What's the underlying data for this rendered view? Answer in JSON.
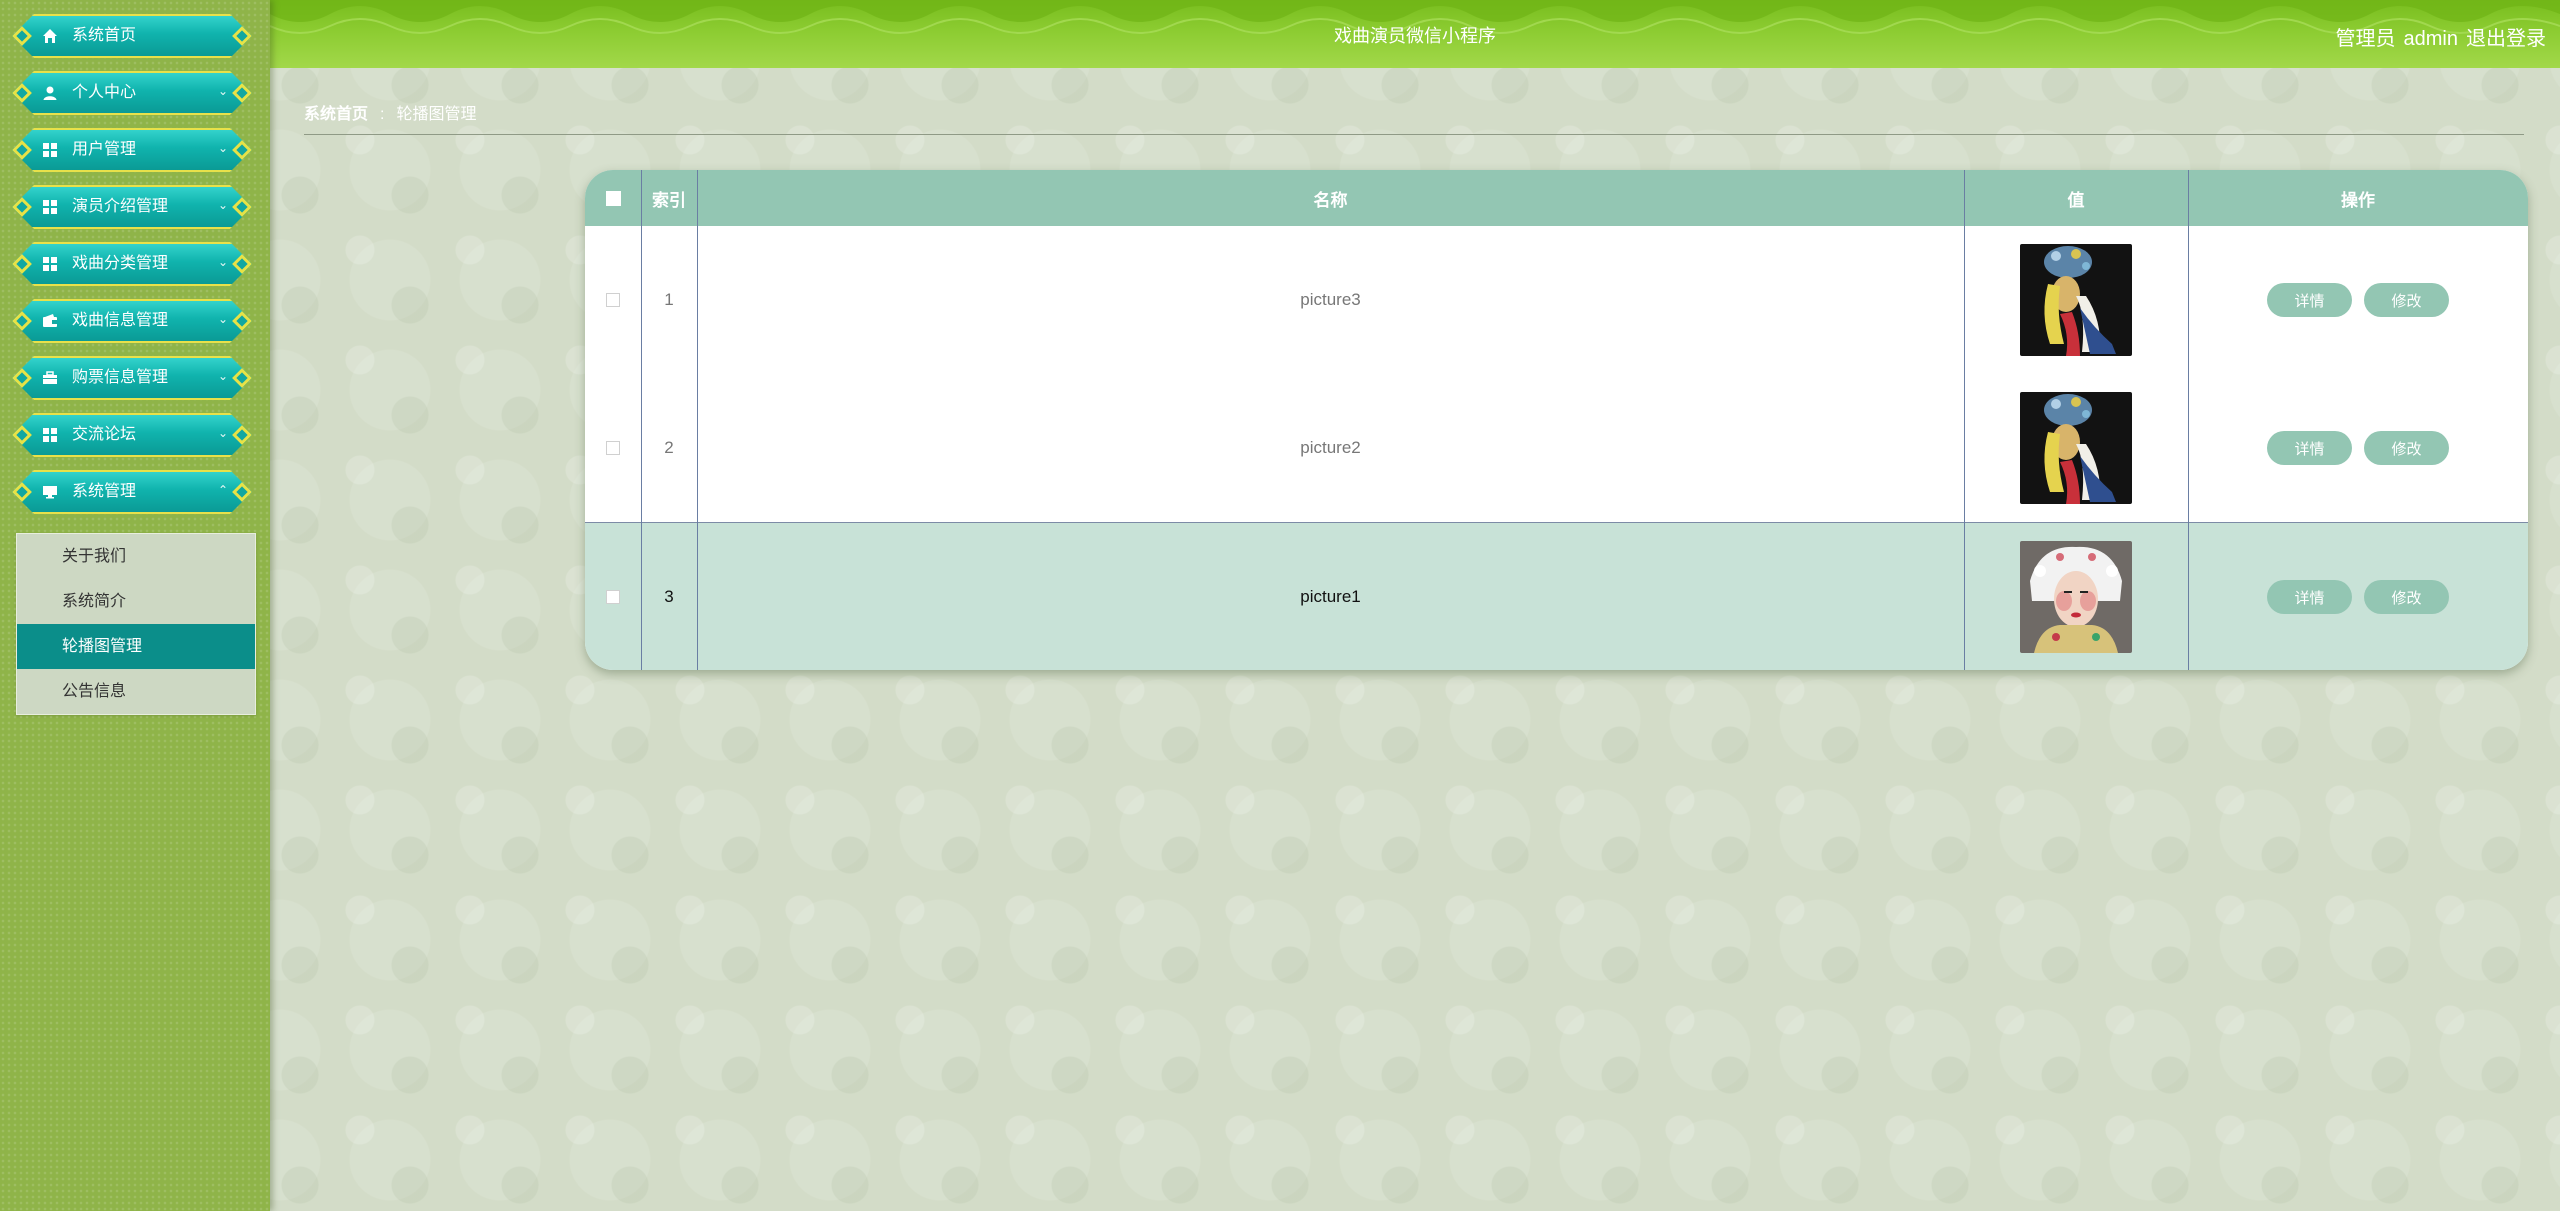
{
  "header": {
    "title": "戏曲演员微信小程序",
    "role": "管理员",
    "username": "admin",
    "logout_label": "退出登录"
  },
  "sidebar": {
    "items": [
      {
        "label": "系统首页",
        "icon": "home-icon",
        "has_arrow": false
      },
      {
        "label": "个人中心",
        "icon": "user-icon",
        "has_arrow": true
      },
      {
        "label": "用户管理",
        "icon": "grid-icon",
        "has_arrow": true
      },
      {
        "label": "演员介绍管理",
        "icon": "grid-icon",
        "has_arrow": true
      },
      {
        "label": "戏曲分类管理",
        "icon": "grid-icon",
        "has_arrow": true
      },
      {
        "label": "戏曲信息管理",
        "icon": "wallet-icon",
        "has_arrow": true
      },
      {
        "label": "购票信息管理",
        "icon": "briefcase-icon",
        "has_arrow": true
      },
      {
        "label": "交流论坛",
        "icon": "grid-icon",
        "has_arrow": true
      },
      {
        "label": "系统管理",
        "icon": "monitor-icon",
        "has_arrow": true,
        "expanded": true
      }
    ],
    "submenu": [
      {
        "label": "关于我们"
      },
      {
        "label": "系统简介"
      },
      {
        "label": "轮播图管理",
        "active": true
      },
      {
        "label": "公告信息"
      }
    ]
  },
  "breadcrumb": {
    "home": "系统首页",
    "separator": ":",
    "current": "轮播图管理"
  },
  "table": {
    "columns": [
      "索引",
      "名称",
      "值",
      "操作"
    ],
    "rows": [
      {
        "index": "1",
        "name": "picture3",
        "image": "opera-performer-yellow-costume"
      },
      {
        "index": "2",
        "name": "picture2",
        "image": "opera-performer-yellow-costume"
      },
      {
        "index": "3",
        "name": "picture1",
        "image": "opera-performer-white-headdress",
        "highlighted": true
      }
    ],
    "actions": {
      "detail": "详情",
      "edit": "修改"
    }
  },
  "colors": {
    "header_green": "#8ccc31",
    "menu_teal": "#10b3ad",
    "menu_border": "#e8e14a",
    "table_header": "#93c6b3",
    "active_submenu": "#0b8e8a",
    "highlight_row": "#c8e2d7"
  }
}
